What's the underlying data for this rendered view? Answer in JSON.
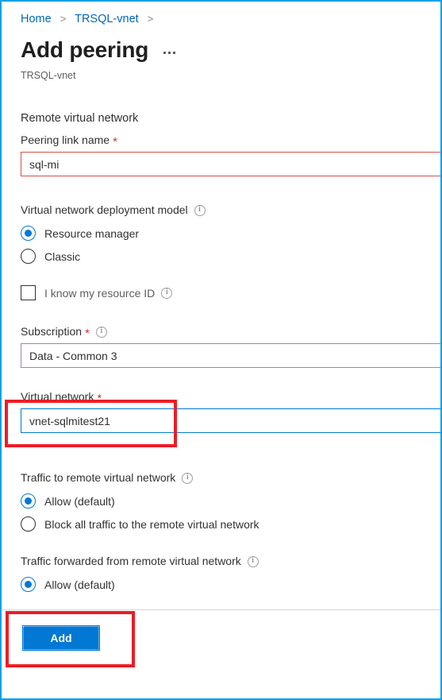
{
  "breadcrumb": {
    "items": [
      {
        "label": "Home",
        "type": "link"
      },
      {
        "label": "TRSQL-vnet",
        "type": "link"
      }
    ],
    "separator": ">"
  },
  "header": {
    "title": "Add peering",
    "subtitle": "TRSQL-vnet",
    "more_menu_label": "..."
  },
  "sections": {
    "remote_virtual_network": {
      "heading": "Remote virtual network",
      "peering_link_name": {
        "label": "Peering link name",
        "required": "*",
        "value": "sql-mi",
        "placeholder": ""
      },
      "deployment_model": {
        "label": "Virtual network deployment model",
        "options": [
          {
            "label": "Resource manager",
            "selected": true
          },
          {
            "label": "Classic",
            "selected": false
          }
        ]
      },
      "resource_id_checkbox": {
        "label": "I know my resource ID",
        "checked": false
      },
      "subscription": {
        "label": "Subscription",
        "required": "*",
        "value": "Data - Common 3"
      },
      "virtual_network": {
        "label": "Virtual network",
        "required": "*",
        "value": "vnet-sqlmitest21"
      },
      "traffic_to_remote": {
        "label": "Traffic to remote virtual network",
        "options": [
          {
            "label": "Allow (default)",
            "selected": true
          },
          {
            "label": "Block all traffic to the remote virtual network",
            "selected": false
          }
        ]
      },
      "traffic_forwarded": {
        "label": "Traffic forwarded from remote virtual network",
        "options": [
          {
            "label": "Allow (default)",
            "selected": true
          }
        ]
      }
    }
  },
  "footer": {
    "add_label": "Add"
  },
  "icons": {
    "info": "i"
  },
  "colors": {
    "accent_blue": "#0078d4",
    "link_blue": "#0067b8",
    "error_red": "#d6534b",
    "required_red": "#d13438",
    "annotation_red": "#ee1c25",
    "subscription_purple": "#a97bbd",
    "frame_cyan": "#0aa0e8"
  }
}
